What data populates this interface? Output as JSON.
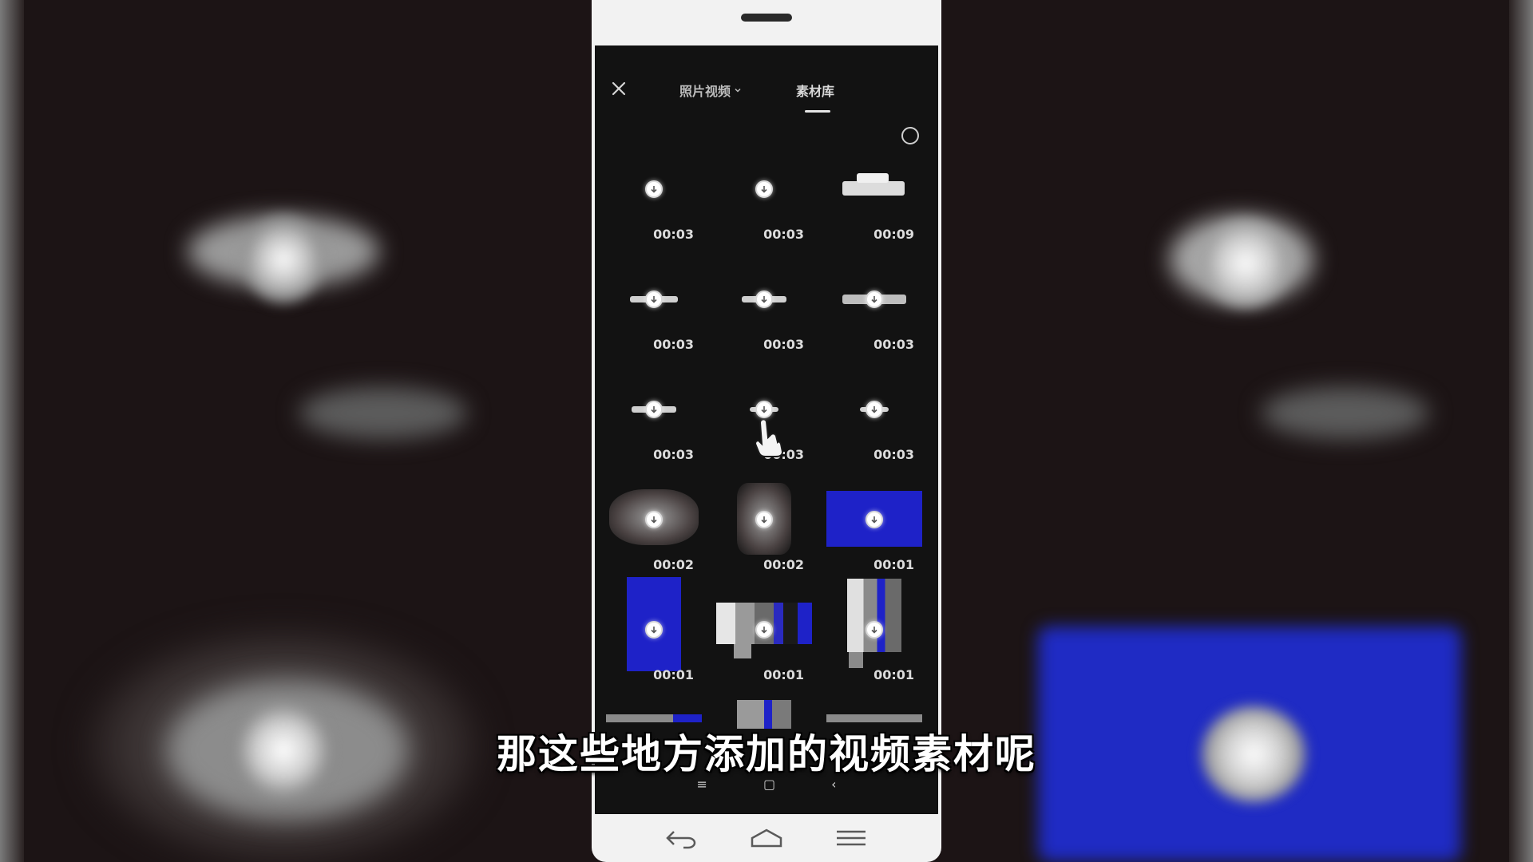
{
  "header": {
    "tab_photo_video": "照片视频",
    "tab_library": "素材库"
  },
  "grid": {
    "items": [
      {
        "duration": "00:03"
      },
      {
        "duration": "00:03"
      },
      {
        "duration": "00:09"
      },
      {
        "duration": "00:03"
      },
      {
        "duration": "00:03"
      },
      {
        "duration": "00:03"
      },
      {
        "duration": "00:03"
      },
      {
        "duration": "00:03"
      },
      {
        "duration": "00:03"
      },
      {
        "duration": "00:02"
      },
      {
        "duration": "00:02"
      },
      {
        "duration": "00:01"
      },
      {
        "duration": "00:01"
      },
      {
        "duration": "00:01"
      },
      {
        "duration": "00:01"
      }
    ]
  },
  "caption": "那这些地方添加的视频素材呢",
  "colors": {
    "accent_blue": "#1e22c8",
    "background": "#1c1415"
  },
  "icons": [
    "close-icon",
    "chevron-down-icon",
    "download-icon",
    "select-circle-icon",
    "hand-pointer-icon",
    "back-icon",
    "home-icon",
    "menu-icon"
  ]
}
